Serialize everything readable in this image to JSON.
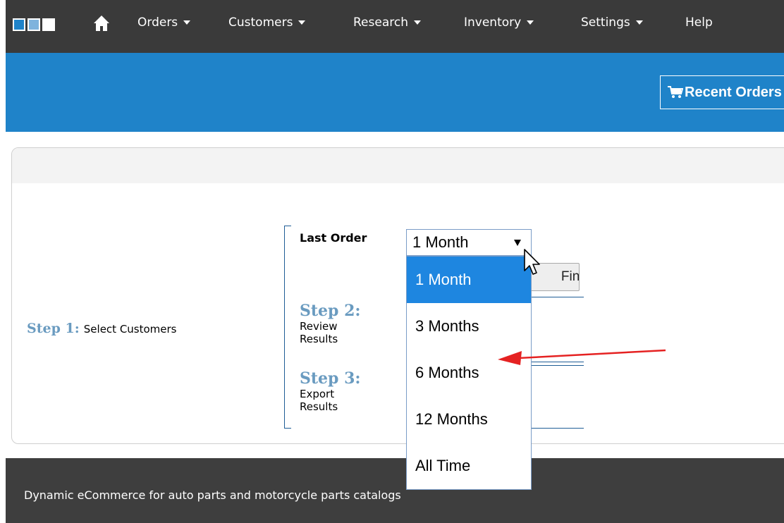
{
  "nav": {
    "brand_colors": [
      "#1f83c9",
      "#7fb3dd",
      "#ffffff"
    ],
    "items": [
      {
        "label": "Orders",
        "caret": true
      },
      {
        "label": "Customers",
        "caret": true
      },
      {
        "label": "Research",
        "caret": true
      },
      {
        "label": "Inventory",
        "caret": true
      },
      {
        "label": "Settings",
        "caret": true
      },
      {
        "label": "Help",
        "caret": false
      }
    ]
  },
  "header": {
    "recent_orders_label": "Recent Orders",
    "accent_color": "#1f83c9"
  },
  "steps": {
    "step1": {
      "num": "Step 1:",
      "desc": "Select Customers"
    },
    "step2": {
      "num": "Step 2:",
      "desc_line1": "Review",
      "desc_line2": "Results"
    },
    "step3": {
      "num": "Step 3:",
      "desc_line1": "Export",
      "desc_line2": "Results"
    }
  },
  "filter": {
    "label": "Last Order",
    "selected": "1 Month",
    "options": [
      "1 Month",
      "3 Months",
      "6 Months",
      "12 Months",
      "All Time"
    ],
    "behind_button_label": "Find Customers"
  },
  "footer": {
    "tagline": "Dynamic eCommerce for auto parts and motorcycle parts catalogs"
  }
}
